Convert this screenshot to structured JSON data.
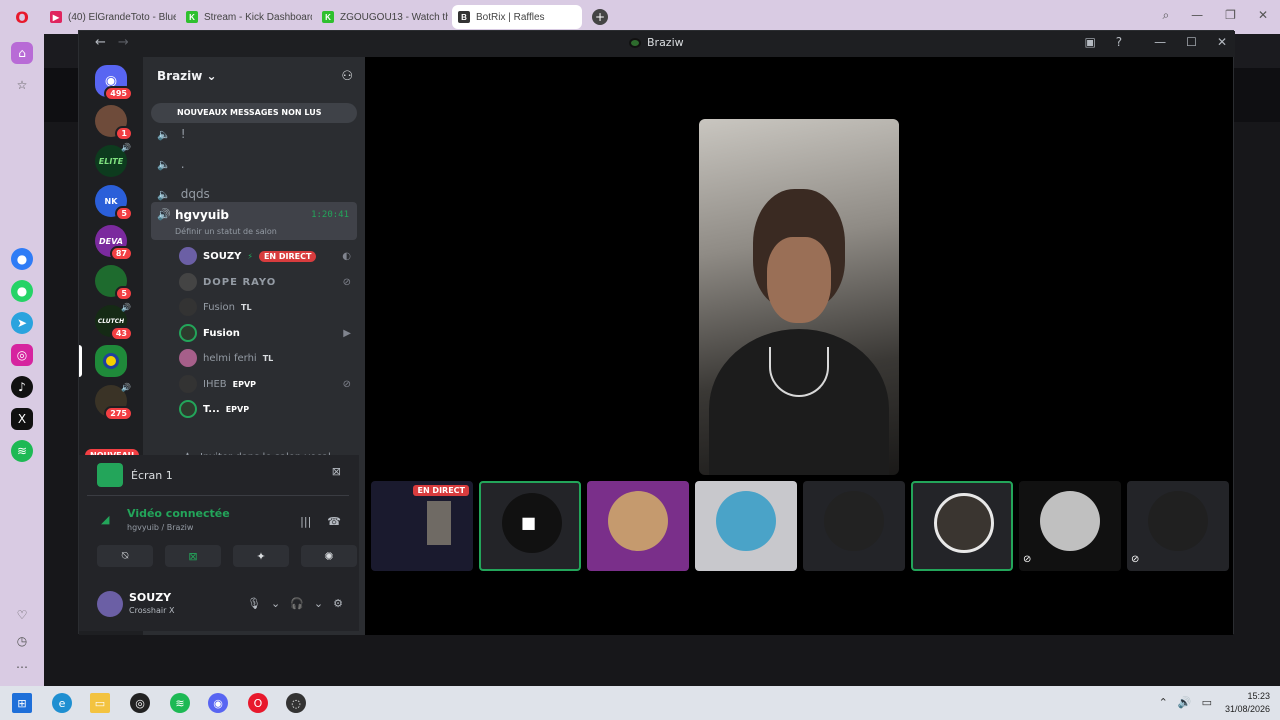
{
  "browser": {
    "logo": "O",
    "tabs": [
      {
        "label": "(40) ElGrandeToto - Blue",
        "favicon_color": "#e0245e",
        "active": false
      },
      {
        "label": "Stream - Kick Dashboard",
        "favicon_color": "#2ec02e",
        "active": false
      },
      {
        "label": "ZGOUGOU13 - Watch the",
        "favicon_color": "#2ec02e",
        "active": false
      },
      {
        "label": "BotRix | Raffles",
        "favicon_color": "#333333",
        "active": true
      }
    ],
    "new_tab": "+",
    "search_icon": "⌕"
  },
  "window": {
    "title": "Braziw",
    "back": "←",
    "forward": "→"
  },
  "guilds": [
    {
      "badge": "495",
      "color": "#5865f2",
      "label": "D"
    },
    {
      "badge": "1",
      "color": "#6e4b3a",
      "label": ""
    },
    {
      "badge": "",
      "color": "#0d3b1e",
      "label": "ELITE"
    },
    {
      "badge": "5",
      "color": "#2b5fd9",
      "label": "NK"
    },
    {
      "badge": "87",
      "color": "#7b2a9e",
      "label": "DEVA"
    },
    {
      "badge": "5",
      "color": "#1e6b2e",
      "label": ""
    },
    {
      "badge": "43",
      "color": "#152a15",
      "label": "CLUTCH"
    },
    {
      "badge": "",
      "color": "#1f8a3a",
      "label": ""
    },
    {
      "badge": "275",
      "color": "#3a3326",
      "label": ""
    }
  ],
  "new_label": "NOUVEAU",
  "server": {
    "name": "Braziw",
    "unread_banner": "NOUVEAUX MESSAGES NON LUS",
    "channels": [
      {
        "name": "!"
      },
      {
        "name": "."
      },
      {
        "name": "dqds"
      }
    ],
    "active_channel": {
      "name": "hgvyuib",
      "timer": "1:20:41",
      "status": "Définir un statut de salon"
    },
    "voice_users": [
      {
        "name": "SOUZY",
        "tag": "",
        "live": "EN DIRECT",
        "color": "#6b5fa5",
        "bright": true
      },
      {
        "name": "DOPE RAYO",
        "tag": "",
        "live": "",
        "color": "#444",
        "bright": false
      },
      {
        "name": "Fusion",
        "tag": "TL",
        "live": "",
        "color": "#333",
        "bright": false
      },
      {
        "name": "Fusion",
        "tag": "",
        "live": "",
        "color": "#2d3b2d",
        "bright": true
      },
      {
        "name": "helmi ferhi",
        "tag": "TL",
        "live": "",
        "color": "#a65f8a",
        "bright": false
      },
      {
        "name": "IHEB",
        "tag": "EPVP",
        "live": "",
        "color": "#333",
        "bright": false
      },
      {
        "name": "T...",
        "tag": "EPVP",
        "live": "",
        "color": "#2d3b2d",
        "bright": true
      }
    ],
    "invite_voice": "Inviter dans le salon vocal"
  },
  "panel": {
    "stream_label": "Écran 1",
    "connected": "Vidéo connectée",
    "connected_sub": "hgvyuib / Braziw",
    "user": {
      "name": "SOUZY",
      "status": "Crosshair X"
    }
  },
  "stage": {
    "live_label": "EN DIRECT",
    "tiles": [
      {
        "color": "#1a1a2e",
        "speaking": false,
        "muted": false
      },
      {
        "color": "#000000",
        "speaking": true,
        "muted": false
      },
      {
        "color": "#7a2f8a",
        "speaking": false,
        "muted": false
      },
      {
        "color": "#4aa3c8",
        "speaking": false,
        "muted": false
      },
      {
        "color": "#222222",
        "speaking": false,
        "muted": false
      },
      {
        "color": "#3a3530",
        "speaking": true,
        "muted": false
      },
      {
        "color": "#c0c0c0",
        "speaking": false,
        "muted": true
      },
      {
        "color": "#202020",
        "speaking": false,
        "muted": true
      }
    ]
  },
  "taskbar": {
    "time": "15:23",
    "date": "31/08/2026"
  }
}
